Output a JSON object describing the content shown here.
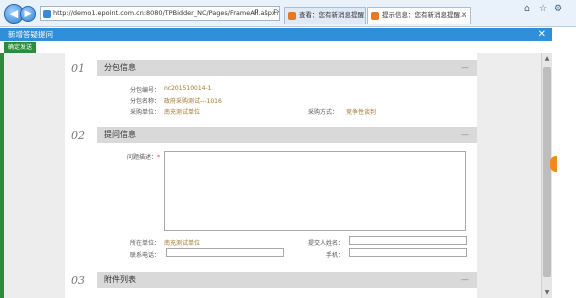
{
  "browser": {
    "url": "http://demo1.epoint.com.cn:8080/TPBidder_NC/Pages/FrameAll.aspx?t=",
    "address_tools": "ρ - c",
    "tabs": [
      {
        "label": "查看：您有新消息提醒，请点击查",
        "active": false
      },
      {
        "label": "提示信息：您有新消息提醒...",
        "active": true
      }
    ],
    "window_icons": [
      "home-icon",
      "star-icon",
      "gear-icon"
    ]
  },
  "dialog": {
    "title": "新增答疑提问",
    "close_glyph": "✕",
    "toolbar": {
      "submit_label": "确定发送"
    }
  },
  "sections": [
    {
      "num": "01",
      "title": "分包信息",
      "collapse": "—"
    },
    {
      "num": "02",
      "title": "提问信息",
      "collapse": "—"
    },
    {
      "num": "03",
      "title": "附件列表",
      "collapse": "—"
    }
  ],
  "package_info": {
    "code_label": "分包编号：",
    "code_value": "nc201510014-1",
    "name_label": "分包名称：",
    "name_value": "政府采购测试---1016",
    "unit_label": "采购单位：",
    "unit_value": "南充测试单位",
    "method_label": "采购方式：",
    "method_value": "竞争性谈判"
  },
  "question_info": {
    "desc_label": "问题描述：",
    "required_mark": "*",
    "desc_value": "",
    "unit_label": "所在单位：",
    "unit_value": "南充测试单位",
    "submitter_label": "提交人姓名：",
    "submitter_value": "",
    "phone_label": "联系电话：",
    "phone_value": "",
    "mobile_label": "手机：",
    "mobile_value": ""
  },
  "colors": {
    "dialog_title_bg": "#2f8fd8",
    "submit_bg": "#2e8b3a",
    "value_text": "#a0762a",
    "section_header_bg": "#d9d9d9"
  }
}
